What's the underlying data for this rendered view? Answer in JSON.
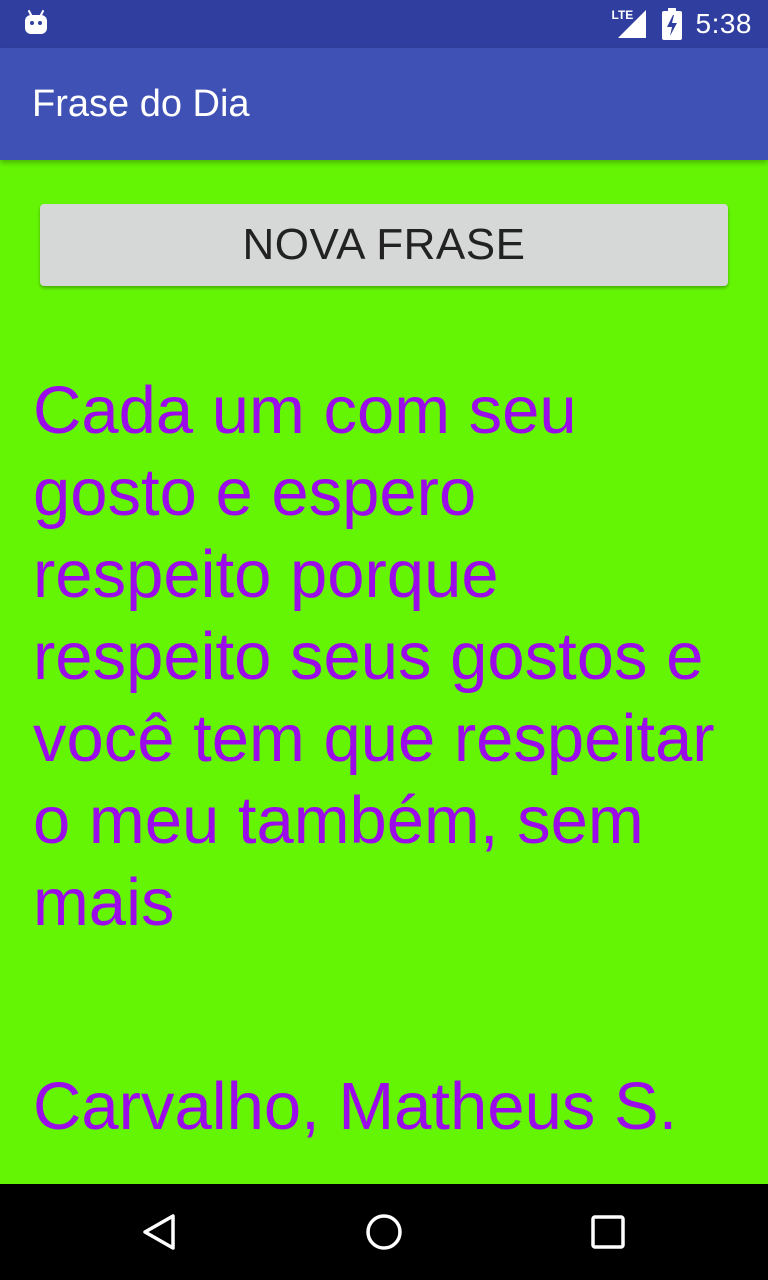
{
  "status_bar": {
    "time": "5:38",
    "network_label": "LTE",
    "icons": [
      "android-notification-icon",
      "signal-icon",
      "battery-charging-icon"
    ]
  },
  "app_bar": {
    "title": "Frase do Dia"
  },
  "main": {
    "button_label": "NOVA FRASE",
    "phrase": "Cada um com seu gosto e espero respeito porque respeito seus gostos e você tem que respeitar o meu também, sem mais",
    "author": "Carvalho, Matheus S."
  },
  "nav_bar": {
    "icons": [
      "back-icon",
      "home-icon",
      "recents-icon"
    ]
  },
  "colors": {
    "status_bar": "#303f9f",
    "app_bar": "#3f51b5",
    "background": "#64f505",
    "text": "#9b0bea",
    "button": "#d6d7d7"
  }
}
